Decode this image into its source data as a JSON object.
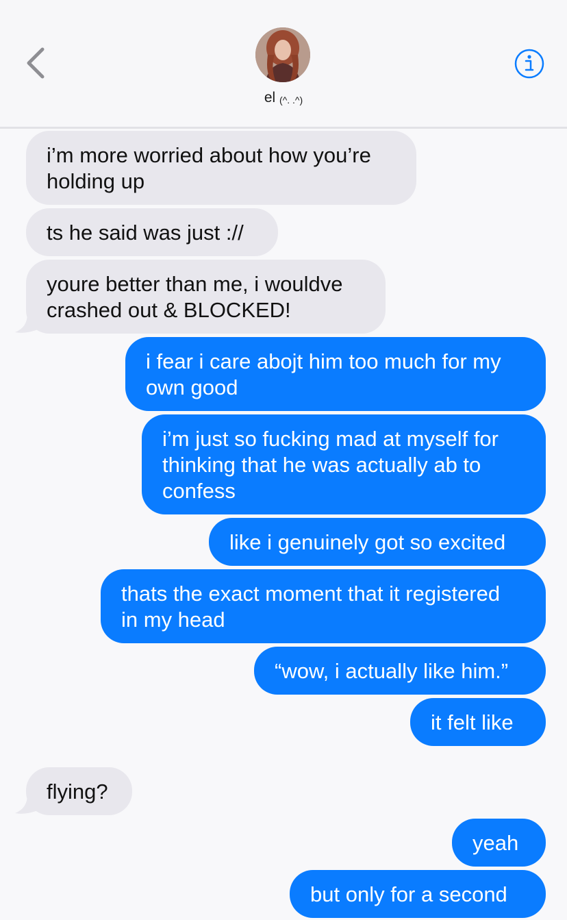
{
  "header": {
    "contact_name": "el",
    "contact_emoticon": "(^. .^)",
    "back_icon": "chevron-left-icon",
    "info_icon": "info-icon",
    "accent_color": "#0a7cff"
  },
  "messages": [
    {
      "direction": "incoming",
      "text": "i’m more worried about how you’re\nholding up"
    },
    {
      "direction": "incoming",
      "text": "ts he said was just ://"
    },
    {
      "direction": "incoming",
      "text": "youre better than me, i wouldve\ncrashed out & BLOCKED!"
    },
    {
      "direction": "outgoing",
      "text": "i fear i care abojt him too much for my\nown good"
    },
    {
      "direction": "outgoing",
      "text": "i’m just so fucking mad at myself for\nthinking that he was actually ab to\nconfess"
    },
    {
      "direction": "outgoing",
      "text": "like i genuinely got so excited"
    },
    {
      "direction": "outgoing",
      "text": "thats the exact moment that it registered\nin my head"
    },
    {
      "direction": "outgoing",
      "text": "“wow, i actually like him.”"
    },
    {
      "direction": "outgoing",
      "text": "it felt like"
    },
    {
      "direction": "incoming",
      "text": "flying?"
    },
    {
      "direction": "outgoing",
      "text": "yeah"
    },
    {
      "direction": "outgoing",
      "text": "but only for a second"
    }
  ],
  "colors": {
    "incoming_bubble": "#e8e7ed",
    "outgoing_bubble": "#0a7cff",
    "background": "#f8f8fa"
  }
}
